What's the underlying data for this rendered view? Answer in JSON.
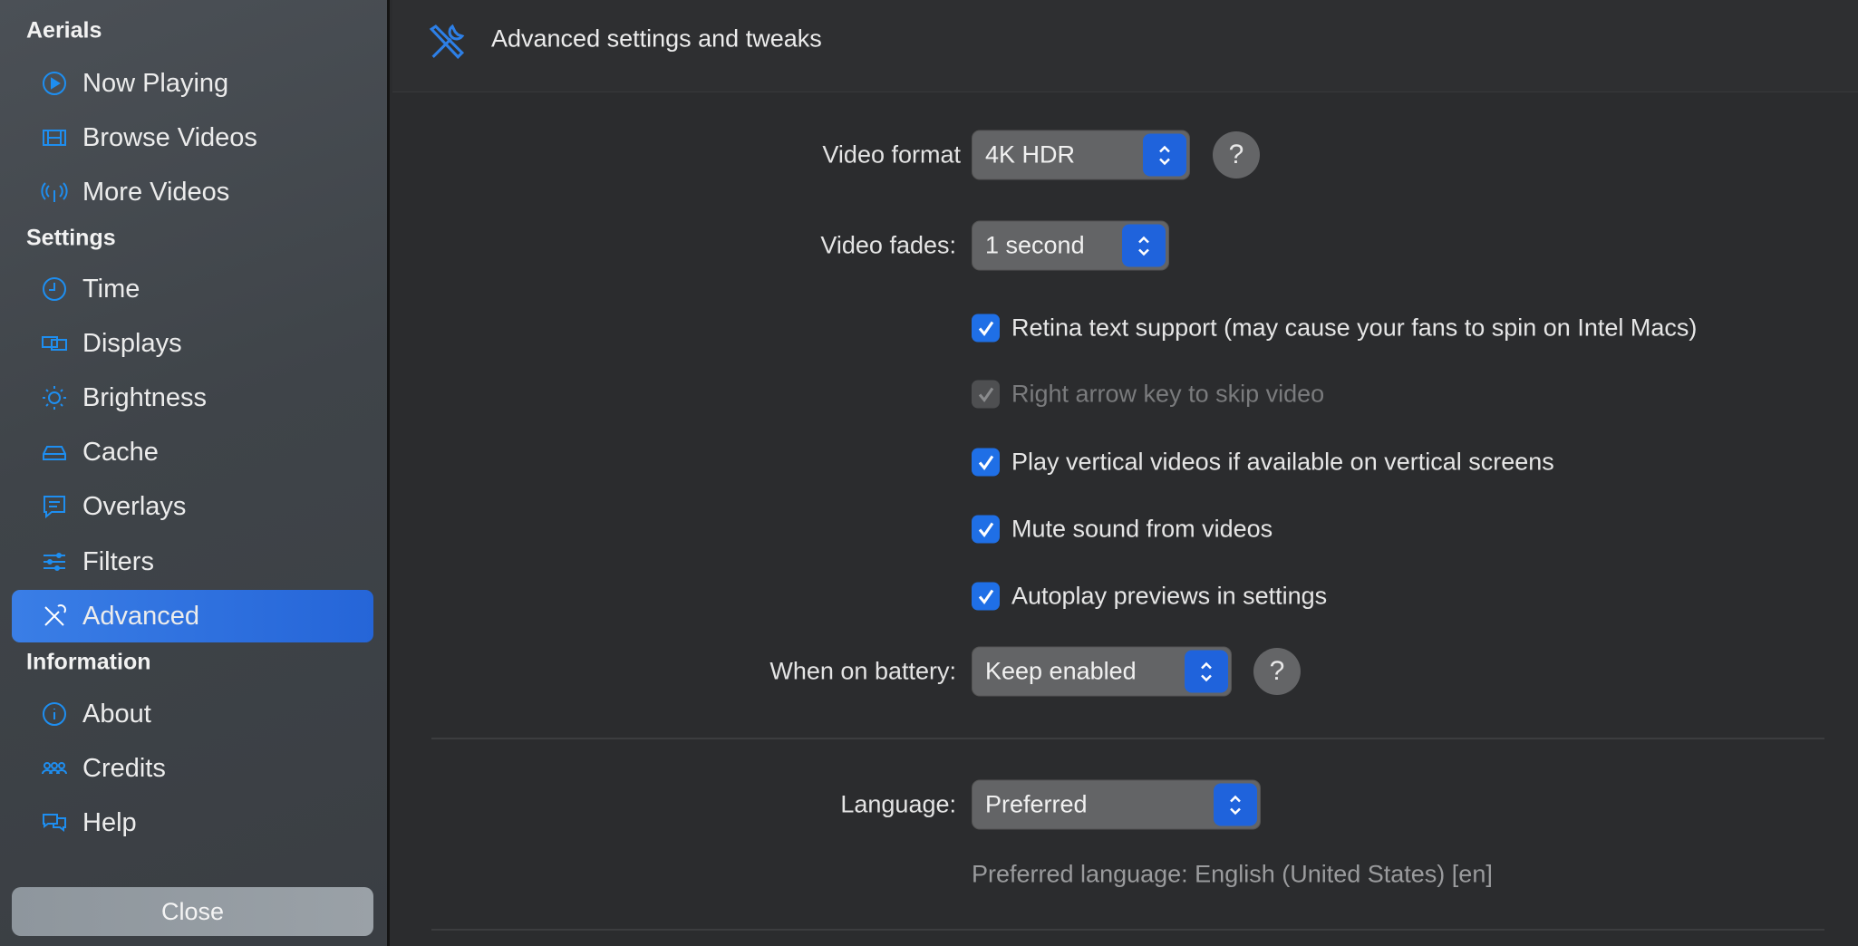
{
  "sidebar": {
    "sections": [
      {
        "title": "Aerials",
        "items": [
          {
            "label": "Now Playing",
            "icon": "play-circle-icon"
          },
          {
            "label": "Browse Videos",
            "icon": "film-icon"
          },
          {
            "label": "More Videos",
            "icon": "antenna-icon"
          }
        ]
      },
      {
        "title": "Settings",
        "items": [
          {
            "label": "Time",
            "icon": "clock-icon"
          },
          {
            "label": "Displays",
            "icon": "displays-icon"
          },
          {
            "label": "Brightness",
            "icon": "sun-icon"
          },
          {
            "label": "Cache",
            "icon": "drive-icon"
          },
          {
            "label": "Overlays",
            "icon": "message-icon"
          },
          {
            "label": "Filters",
            "icon": "sliders-icon"
          },
          {
            "label": "Advanced",
            "icon": "tools-icon",
            "selected": true
          }
        ]
      },
      {
        "title": "Information",
        "items": [
          {
            "label": "About",
            "icon": "info-icon"
          },
          {
            "label": "Credits",
            "icon": "people-icon"
          },
          {
            "label": "Help",
            "icon": "chat-bubbles-icon"
          }
        ]
      }
    ],
    "close_label": "Close"
  },
  "header": {
    "title": "Advanced settings and tweaks",
    "icon": "tools-icon"
  },
  "settings": {
    "video_format": {
      "label": "Video format",
      "value": "4K HDR"
    },
    "video_fades": {
      "label": "Video fades:",
      "value": "1 second"
    },
    "checkboxes": [
      {
        "label": "Retina text support (may cause your fans to spin on Intel Macs)",
        "checked": true,
        "enabled": true
      },
      {
        "label": "Right arrow key to skip video",
        "checked": true,
        "enabled": false
      },
      {
        "label": "Play vertical videos if available on vertical screens",
        "checked": true,
        "enabled": true
      },
      {
        "label": "Mute sound from videos",
        "checked": true,
        "enabled": true
      },
      {
        "label": "Autoplay previews in settings",
        "checked": true,
        "enabled": true
      }
    ],
    "battery": {
      "label": "When on battery:",
      "value": "Keep enabled"
    },
    "language": {
      "label": "Language:",
      "value": "Preferred",
      "note": "Preferred language: English (United States) [en]"
    },
    "help_label": "?"
  },
  "colors": {
    "accent": "#1f63dc",
    "icon_blue": "#1e8ef0",
    "background": "#2b2c2e"
  }
}
